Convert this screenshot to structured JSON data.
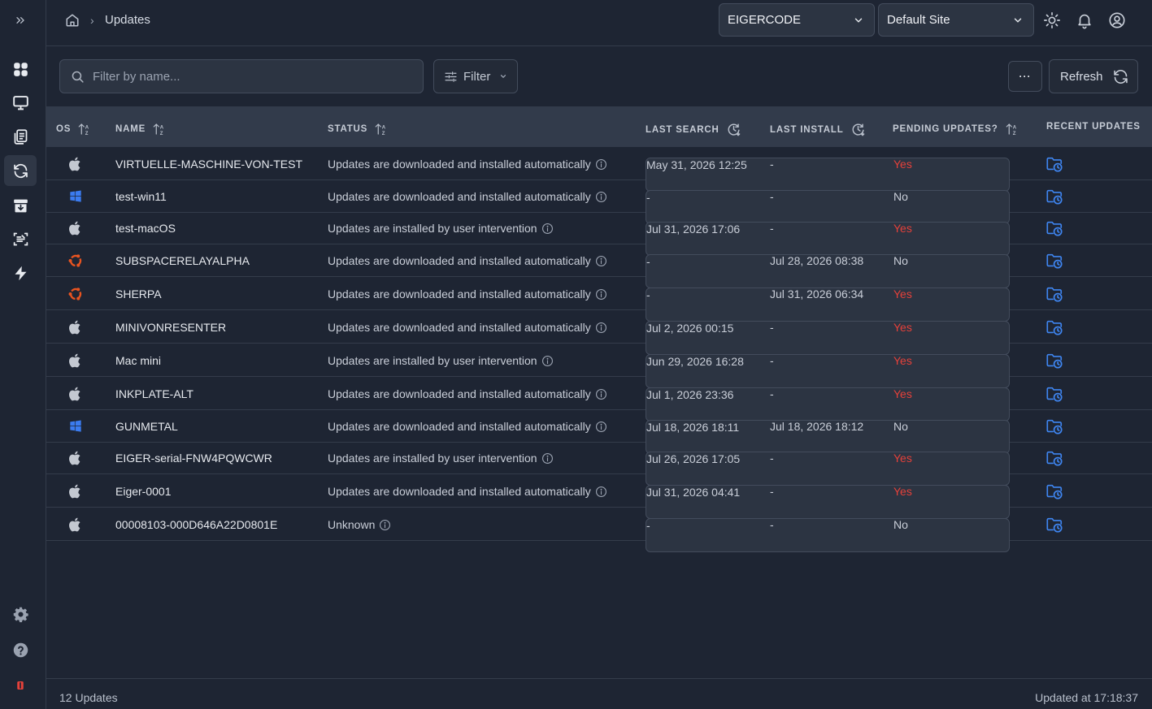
{
  "sidebar": {
    "items": [
      {
        "icon": "expand-icon"
      },
      {
        "icon": "dashboard-icon"
      },
      {
        "icon": "monitor-icon"
      },
      {
        "icon": "documents-icon"
      },
      {
        "icon": "refresh-icon",
        "active": true
      },
      {
        "icon": "archive-download-icon"
      },
      {
        "icon": "scan-icon"
      },
      {
        "icon": "lightning-icon"
      },
      {
        "icon": "gear-icon"
      },
      {
        "icon": "help-icon"
      },
      {
        "icon": "logo-icon"
      }
    ]
  },
  "header": {
    "breadcrumb": "Updates",
    "org_select": "EIGERCODE",
    "site_select": "Default Site"
  },
  "toolbar": {
    "search_placeholder": "Filter by name...",
    "filter_label": "Filter",
    "more_label": "···",
    "refresh_label": "Refresh"
  },
  "table": {
    "columns": [
      "OS",
      "NAME",
      "STATUS",
      "LAST SEARCH",
      "LAST INSTALL",
      "PENDING UPDATES?",
      "RECENT UPDATES"
    ],
    "rows": [
      {
        "os": "apple",
        "name": "VIRTUELLE-MASCHINE-VON-TEST",
        "status": "Updates are downloaded and installed automatically",
        "last_search": "May 31, 2026 12:25",
        "last_install": "-",
        "pending": "Yes"
      },
      {
        "os": "windows",
        "name": "test-win11",
        "status": "Updates are downloaded and installed automatically",
        "last_search": "-",
        "last_install": "-",
        "pending": "No"
      },
      {
        "os": "apple",
        "name": "test-macOS",
        "status": "Updates are installed by user intervention",
        "last_search": "Jul 31, 2026 17:06",
        "last_install": "-",
        "pending": "Yes"
      },
      {
        "os": "ubuntu",
        "name": "SUBSPACERELAYALPHA",
        "status": "Updates are downloaded and installed automatically",
        "last_search": "-",
        "last_install": "Jul 28, 2026 08:38",
        "pending": "No"
      },
      {
        "os": "ubuntu",
        "name": "SHERPA",
        "status": "Updates are downloaded and installed automatically",
        "last_search": "-",
        "last_install": "Jul 31, 2026 06:34",
        "pending": "Yes"
      },
      {
        "os": "apple",
        "name": "MINIVONRESENTER",
        "status": "Updates are downloaded and installed automatically",
        "last_search": "Jul 2, 2026 00:15",
        "last_install": "-",
        "pending": "Yes"
      },
      {
        "os": "apple",
        "name": "Mac mini",
        "status": "Updates are installed by user intervention",
        "last_search": "Jun 29, 2026 16:28",
        "last_install": "-",
        "pending": "Yes"
      },
      {
        "os": "apple",
        "name": "INKPLATE-ALT",
        "status": "Updates are downloaded and installed automatically",
        "last_search": "Jul 1, 2026 23:36",
        "last_install": "-",
        "pending": "Yes"
      },
      {
        "os": "windows",
        "name": "GUNMETAL",
        "status": "Updates are downloaded and installed automatically",
        "last_search": "Jul 18, 2026 18:11",
        "last_install": "Jul 18, 2026 18:12",
        "pending": "No"
      },
      {
        "os": "apple",
        "name": "EIGER-serial-FNW4PQWCWR",
        "status": "Updates are installed by user intervention",
        "last_search": "Jul 26, 2026 17:05",
        "last_install": "-",
        "pending": "Yes"
      },
      {
        "os": "apple",
        "name": "Eiger-0001",
        "status": "Updates are downloaded and installed automatically",
        "last_search": "Jul 31, 2026 04:41",
        "last_install": "-",
        "pending": "Yes"
      },
      {
        "os": "apple",
        "name": "00008103-000D646A22D0801E",
        "status": "Unknown",
        "last_search": "-",
        "last_install": "-",
        "pending": "No"
      }
    ]
  },
  "footer": {
    "count": "12 Updates",
    "updated": "Updated at 17:18:37"
  },
  "colors": {
    "background": "#1e2533",
    "header_row": "#323b4b",
    "pending_yes": "#e5413a",
    "accent_blue": "#3f86f2",
    "ubuntu_orange": "#e95420"
  }
}
